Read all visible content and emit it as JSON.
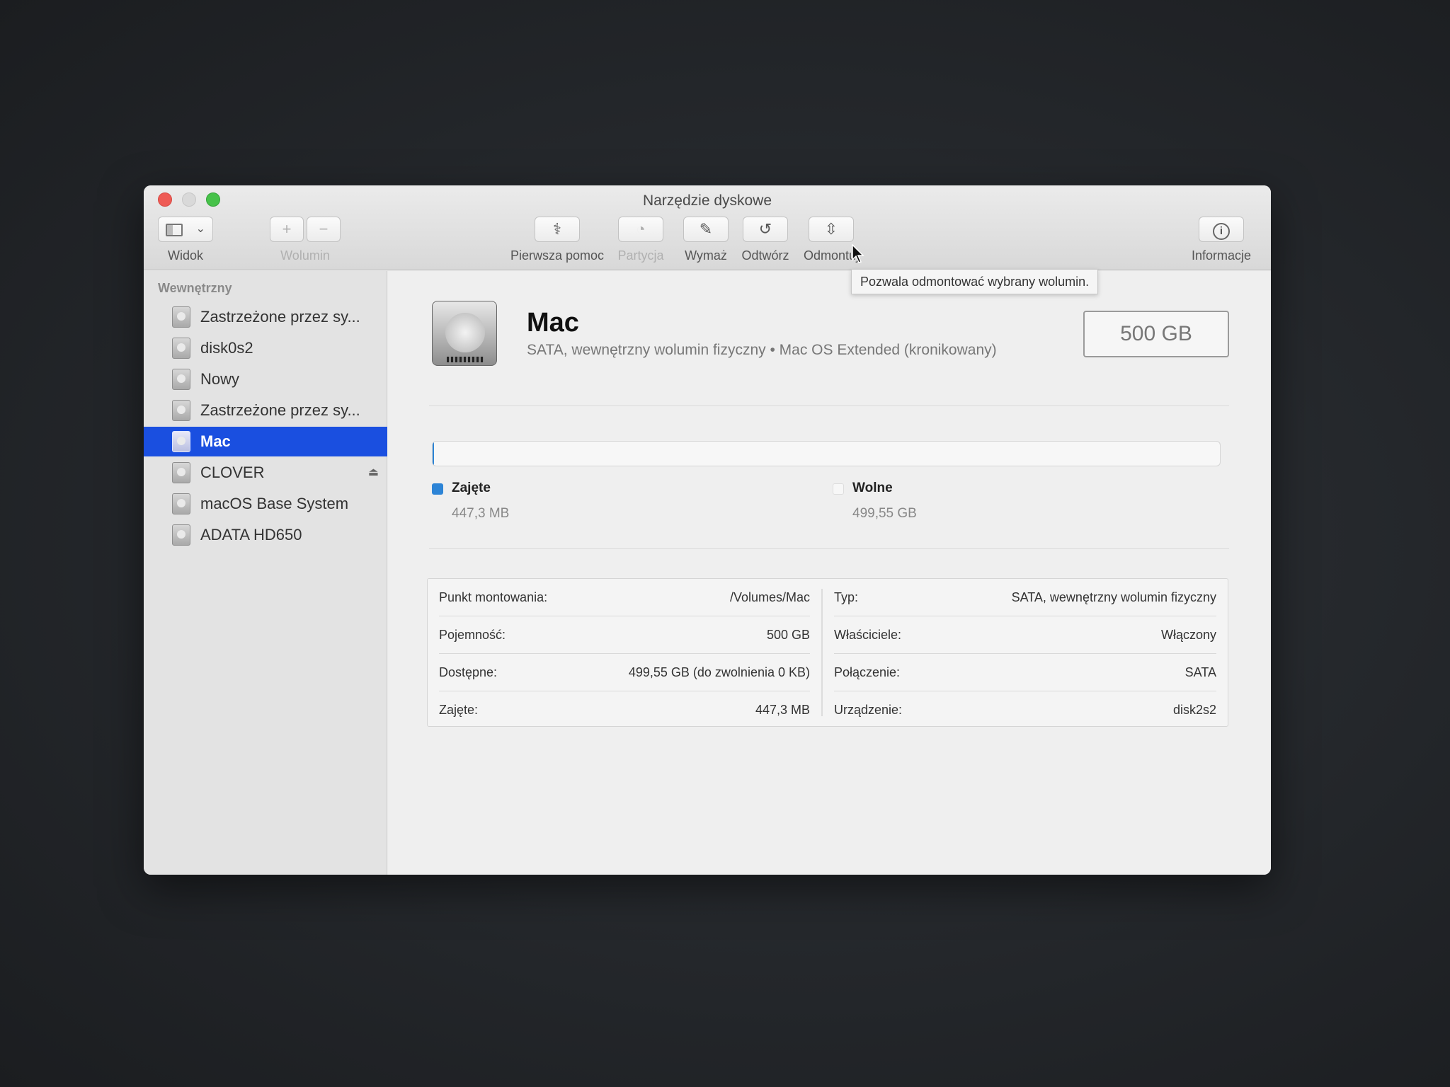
{
  "window": {
    "title": "Narzędzie dyskowe"
  },
  "toolbar": {
    "view_label": "Widok",
    "volume_label": "Wolumin",
    "first_aid_label": "Pierwsza pomoc",
    "partition_label": "Partycja",
    "erase_label": "Wymaż",
    "restore_label": "Odtwórz",
    "unmount_label": "Odmontuj",
    "info_label": "Informacje",
    "icons": [
      "sidebar-icon",
      "chevron-down-icon",
      "plus-icon",
      "minus-icon",
      "stethoscope-icon",
      "pie-icon",
      "pencil-icon",
      "restore-icon",
      "unmount-icon",
      "info-icon"
    ]
  },
  "sidebar": {
    "section": "Wewnętrzny",
    "items": [
      {
        "label": "Zastrzeżone przez sy...",
        "selected": false
      },
      {
        "label": "disk0s2",
        "selected": false
      },
      {
        "label": "Nowy",
        "selected": false
      },
      {
        "label": "Zastrzeżone przez sy...",
        "selected": false
      },
      {
        "label": "Mac",
        "selected": true
      },
      {
        "label": "CLOVER",
        "selected": false,
        "eject": true
      },
      {
        "label": "macOS Base System",
        "selected": false
      },
      {
        "label": "ADATA HD650",
        "selected": false
      }
    ]
  },
  "volume": {
    "name": "Mac",
    "subtitle": "SATA, wewnętrzny wolumin fizyczny • Mac OS Extended (kronikowany)",
    "size": "500 GB",
    "used_fraction": 0.0009
  },
  "legend": {
    "used": {
      "label": "Zajęte",
      "value": "447,3 MB",
      "color": "#2d84d6"
    },
    "free": {
      "label": "Wolne",
      "value": "499,55 GB",
      "color": "#f7f7f7"
    }
  },
  "details": {
    "left": [
      {
        "key": "Punkt montowania:",
        "value": "/Volumes/Mac"
      },
      {
        "key": "Pojemność:",
        "value": "500 GB"
      },
      {
        "key": "Dostępne:",
        "value": "499,55 GB (do zwolnienia 0 KB)"
      },
      {
        "key": "Zajęte:",
        "value": "447,3 MB"
      }
    ],
    "right": [
      {
        "key": "Typ:",
        "value": "SATA, wewnętrzny wolumin fizyczny"
      },
      {
        "key": "Właściciele:",
        "value": "Włączony"
      },
      {
        "key": "Połączenie:",
        "value": "SATA"
      },
      {
        "key": "Urządzenie:",
        "value": "disk2s2"
      }
    ]
  },
  "tooltip": "Pozwala odmontować wybrany wolumin."
}
